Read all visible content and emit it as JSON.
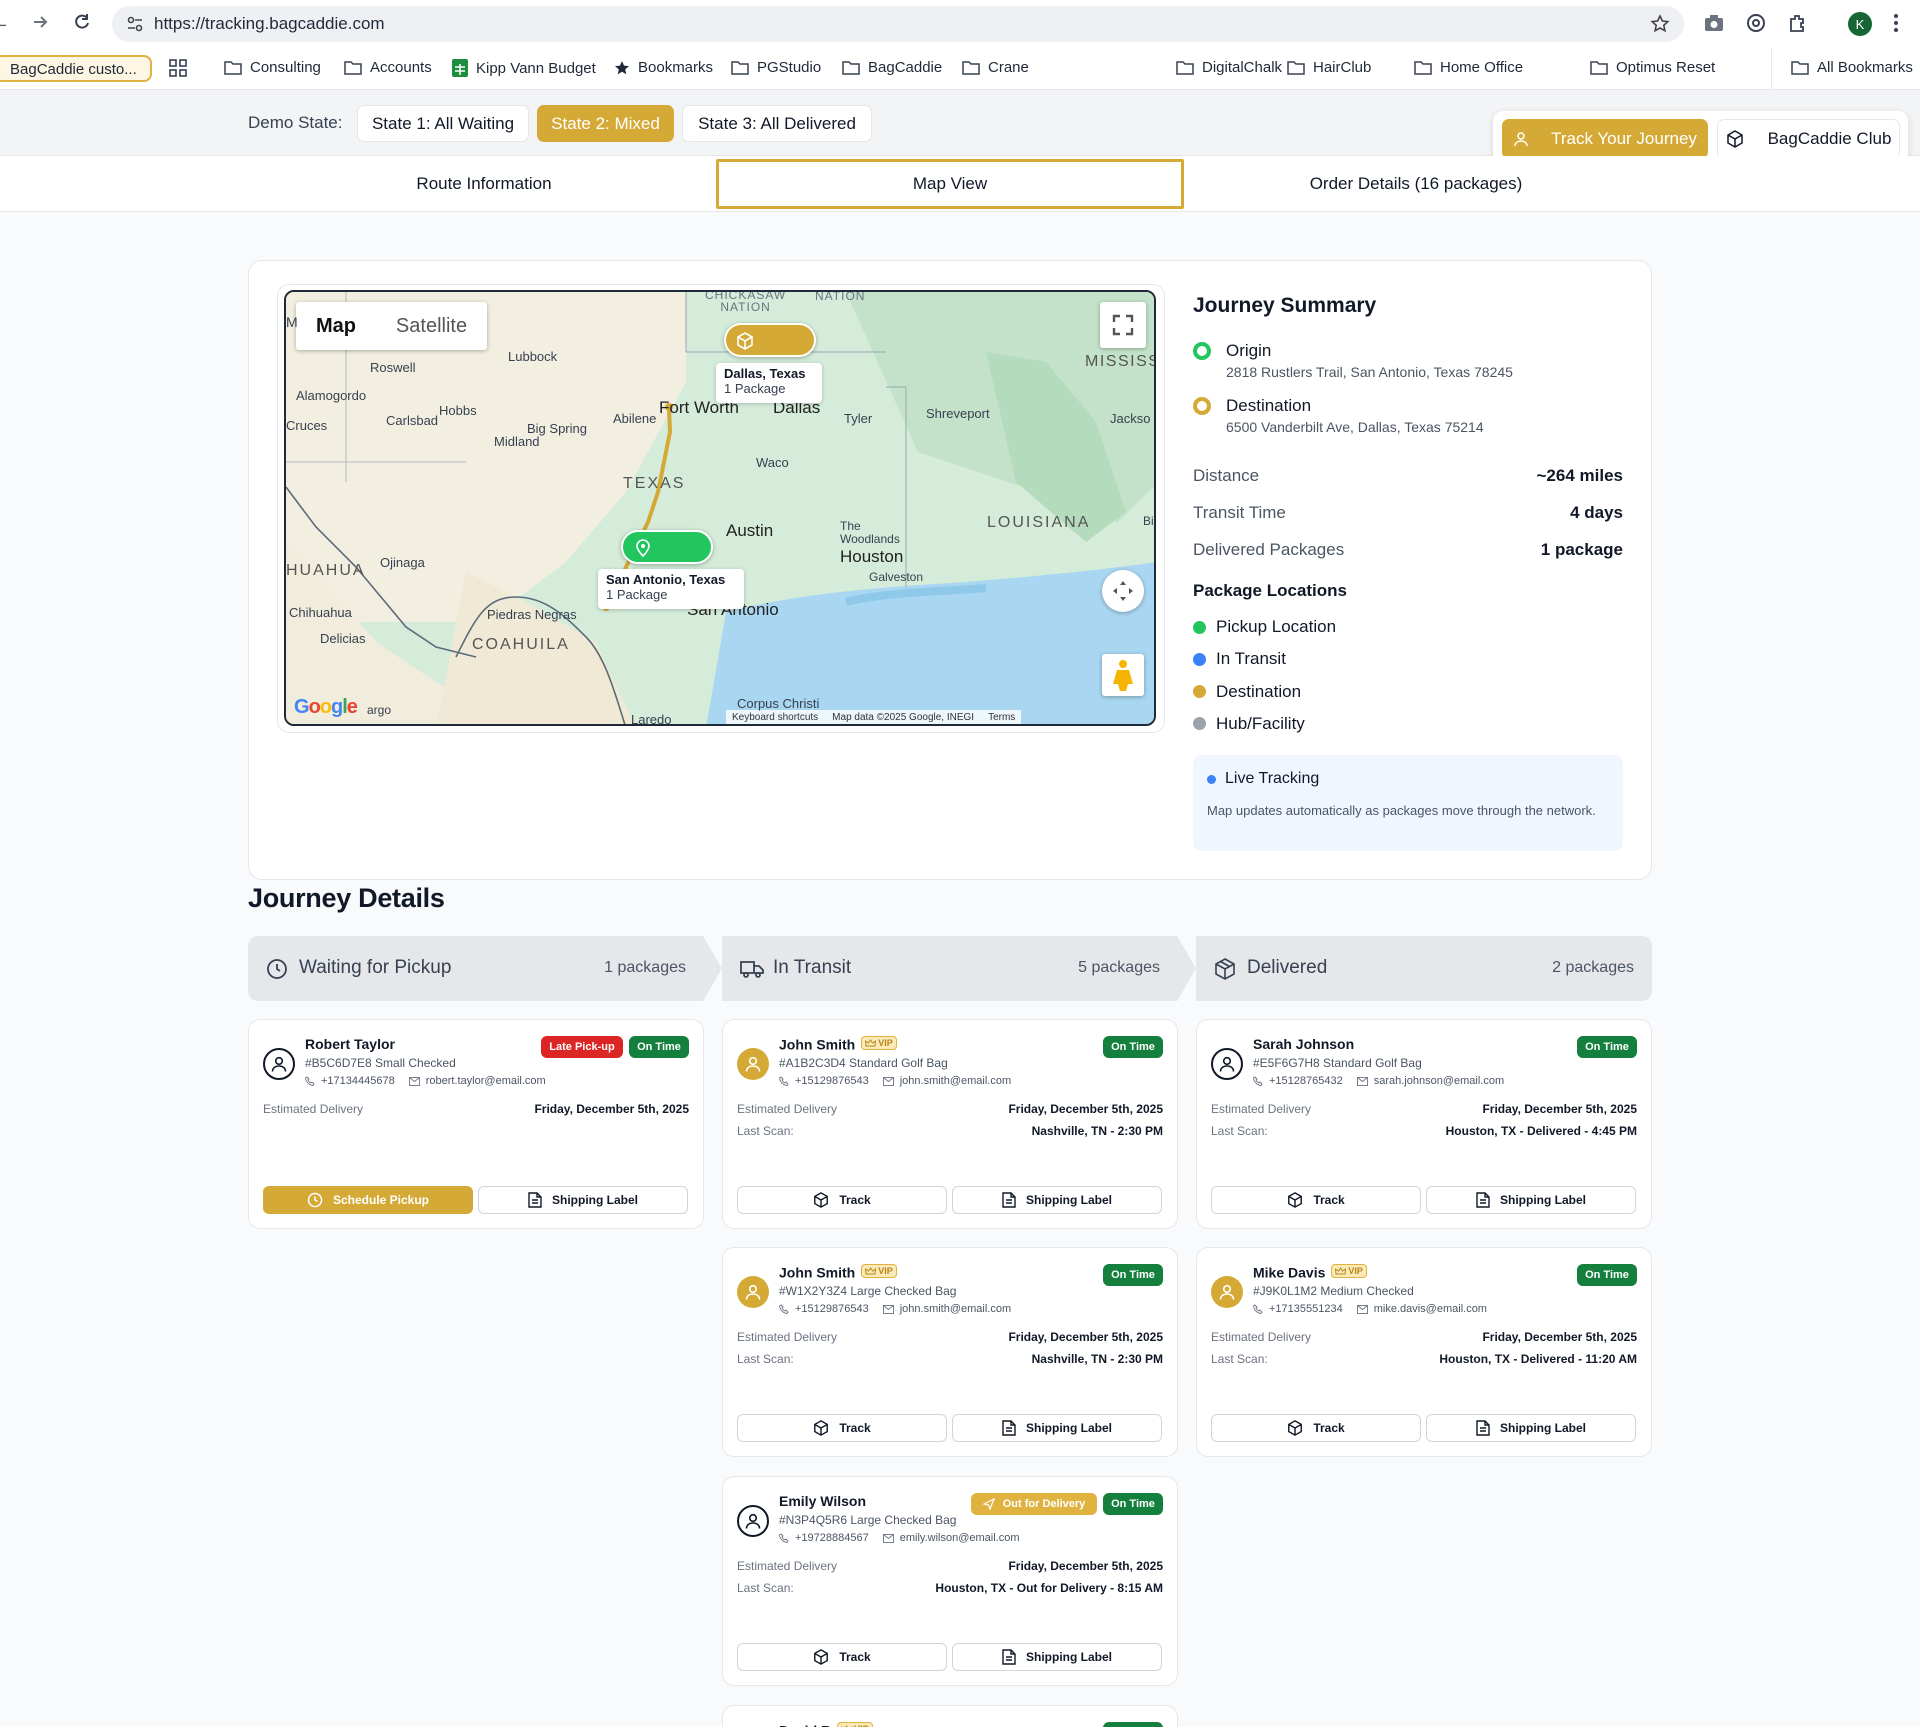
{
  "browser": {
    "url": "https://tracking.bagcaddie.com",
    "profile_initial": "K"
  },
  "bookmarks": {
    "active_tab": "BagCaddie custo...",
    "items": [
      "Consulting",
      "Accounts",
      "Kipp Vann Budget",
      "Bookmarks",
      "PGStudio",
      "BagCaddie",
      "Crane",
      "DigitalChalk",
      "HairClub",
      "Home Office",
      "Optimus Reset"
    ],
    "all": "All Bookmarks"
  },
  "header": {
    "demo_label": "Demo State:",
    "states": [
      "State 1: All Waiting",
      "State 2: Mixed",
      "State 3: All Delivered"
    ],
    "track_journey": "Track Your Journey",
    "club": "BagCaddie Club"
  },
  "tabs": [
    "Route Information",
    "Map View",
    "Order Details (16 packages)"
  ],
  "map": {
    "type_buttons": [
      "Map",
      "Satellite"
    ],
    "origin_popup": {
      "title": "San Antonio, Texas",
      "sub": "1 Package"
    },
    "dest_popup": {
      "title": "Dallas, Texas",
      "sub": "1 Package"
    },
    "labels": {
      "m": "M",
      "chickasaw": "CHICKASAW\nNATION",
      "nation": "NATION",
      "lubbock": "Lubbock",
      "roswell": "Roswell",
      "alamogordo": "Alamogordo",
      "hobbs": "Hobbs",
      "cruces": "Cruces",
      "carlsbad": "Carlsbad",
      "abilene": "Abilene",
      "big_spring": "Big Spring",
      "midland": "Midland",
      "fort_worth": "Fort Worth",
      "dallas": "Dallas",
      "tyler": "Tyler",
      "shreveport": "Shreveport",
      "jackson": "Jackso",
      "mississippi": "MISSISS",
      "texas": "TEXAS",
      "waco": "Waco",
      "austin": "Austin",
      "louisiana": "LOUISIANA",
      "bi": "Bi",
      "the": "The",
      "woodlands": "Woodlands",
      "houston": "Houston",
      "galveston": "Galveston",
      "san_antonio": "San Antonio",
      "chihuahua_state": "HUAHUA",
      "ojinaga": "Ojinaga",
      "chihuahua": "Chihuahua",
      "delicias": "Delicias",
      "piedras": "Piedras Negras",
      "coahuila": "COAHUILA",
      "corpus": "Corpus Christi",
      "laredo": "Laredo",
      "argo": "argo"
    },
    "footer": [
      "Keyboard shortcuts",
      "Map data ©2025 Google, INEGI",
      "Terms"
    ],
    "google": "Google"
  },
  "summary": {
    "title": "Journey Summary",
    "origin_label": "Origin",
    "origin_addr": "2818 Rustlers Trail, San Antonio, Texas 78245",
    "dest_label": "Destination",
    "dest_addr": "6500 Vanderbilt Ave, Dallas, Texas 75214",
    "stats": [
      {
        "label": "Distance",
        "value": "~264 miles"
      },
      {
        "label": "Transit Time",
        "value": "4 days"
      },
      {
        "label": "Delivered Packages",
        "value": "1 package"
      }
    ],
    "locations_title": "Package Locations",
    "legend": [
      {
        "label": "Pickup Location",
        "color": "#22c55e"
      },
      {
        "label": "In Transit",
        "color": "#3b82f6"
      },
      {
        "label": "Destination",
        "color": "#d4a935"
      },
      {
        "label": "Hub/Facility",
        "color": "#9ca3af"
      }
    ],
    "live_title": "Live Tracking",
    "live_text": "Map updates automatically as packages move through the network."
  },
  "journey": {
    "title": "Journey Details",
    "columns": [
      {
        "title": "Waiting for Pickup",
        "count": "1 packages"
      },
      {
        "title": "In Transit",
        "count": "5 packages"
      },
      {
        "title": "Delivered",
        "count": "2 packages"
      }
    ],
    "labels": {
      "est": "Estimated Delivery",
      "last": "Last Scan:",
      "track": "Track",
      "label": "Shipping Label",
      "schedule": "Schedule Pickup",
      "vip": "VIP"
    },
    "cards": [
      {
        "name": "Robert Taylor",
        "sub": "#B5C6D7E8 Small Checked",
        "phone": "+17134445678",
        "email": "robert.taylor@email.com",
        "date": "Friday, December 5th, 2025",
        "badges": [
          "Late Pick-up",
          "On Time"
        ]
      },
      {
        "name": "John Smith",
        "sub": "#A1B2C3D4 Standard Golf Bag",
        "phone": "+15129876543",
        "email": "john.smith@email.com",
        "date": "Friday, December 5th, 2025",
        "scan": "Nashville, TN - 2:30 PM",
        "badges": [
          "On Time"
        ]
      },
      {
        "name": "Sarah Johnson",
        "sub": "#E5F6G7H8 Standard Golf Bag",
        "phone": "+15128765432",
        "email": "sarah.johnson@email.com",
        "date": "Friday, December 5th, 2025",
        "scan": "Houston, TX - Delivered - 4:45 PM",
        "badges": [
          "On Time"
        ]
      },
      {
        "name": "John Smith",
        "sub": "#W1X2Y3Z4 Large Checked Bag",
        "phone": "+15129876543",
        "email": "john.smith@email.com",
        "date": "Friday, December 5th, 2025",
        "scan": "Nashville, TN - 2:30 PM",
        "badges": [
          "On Time"
        ]
      },
      {
        "name": "Mike Davis",
        "sub": "#J9K0L1M2 Medium Checked",
        "phone": "+17135551234",
        "email": "mike.davis@email.com",
        "date": "Friday, December 5th, 2025",
        "scan": "Houston, TX - Delivered - 11:20 AM",
        "badges": [
          "On Time"
        ]
      },
      {
        "name": "Emily Wilson",
        "sub": "#N3P4Q5R6 Large Checked Bag",
        "phone": "+19728884567",
        "email": "emily.wilson@email.com",
        "date": "Friday, December 5th, 2025",
        "scan": "Houston, TX - Out for Delivery - 8:15 AM",
        "badges": [
          "Out for Delivery",
          "On Time"
        ]
      },
      {
        "name": "David B",
        "badges": [
          ""
        ]
      }
    ]
  }
}
